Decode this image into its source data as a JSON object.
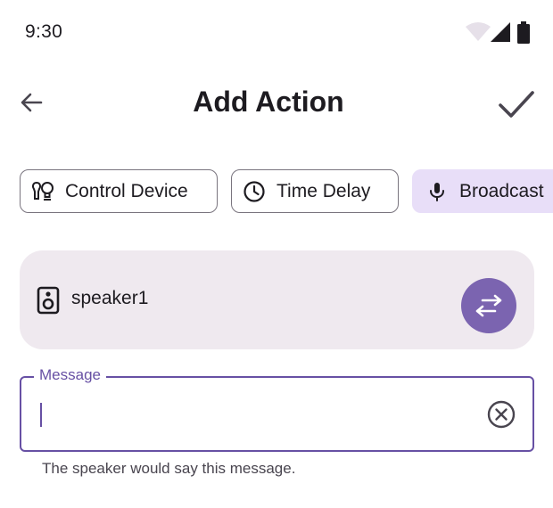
{
  "status_bar": {
    "time": "9:30",
    "icons": [
      "wifi-icon",
      "cellular-signal-icon",
      "battery-icon"
    ]
  },
  "top_bar": {
    "back_icon": "arrow-back-icon",
    "title": "Add Action",
    "confirm_icon": "check-icon"
  },
  "chips": [
    {
      "label": "Control Device",
      "icon": "bulb-icon",
      "selected": false
    },
    {
      "label": "Time Delay",
      "icon": "clock-icon",
      "selected": false
    },
    {
      "label": "Broadcast",
      "icon": "mic-icon",
      "selected": true
    }
  ],
  "device": {
    "icon": "speaker-icon",
    "name": "speaker1",
    "swap_icon": "swap-arrows-icon"
  },
  "message": {
    "label": "Message",
    "value": "",
    "clear_icon": "clear-circle-icon",
    "helper": "The speaker would say this message."
  },
  "colors": {
    "primary": "#6750a4",
    "swap_button": "#7b64b0",
    "chip_selected": "#e8def8",
    "card_background": "#efe9ef",
    "outline": "#79747e",
    "on_surface": "#1d1b20",
    "on_surface_variant": "#49454f"
  }
}
